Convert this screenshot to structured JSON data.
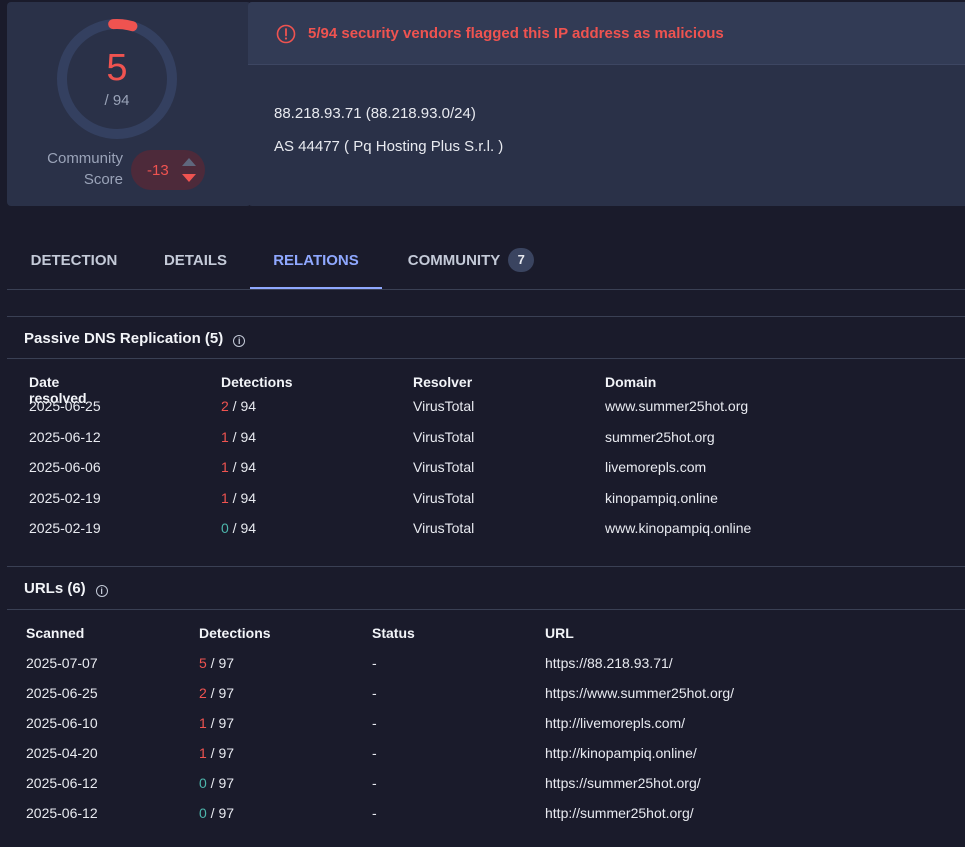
{
  "score": {
    "detections": "5",
    "total": "/ 94",
    "community_label_1": "Community",
    "community_label_2": "Score",
    "community_value": "-13"
  },
  "alert": {
    "text": "5/94 security vendors flagged this IP address as malicious"
  },
  "ip": {
    "line": "88.218.93.71  (88.218.93.0/24)",
    "as_line": "AS 44477  ( Pq Hosting Plus S.r.l. )"
  },
  "tabs": [
    {
      "label": "DETECTION",
      "active": false
    },
    {
      "label": "DETAILS",
      "active": false
    },
    {
      "label": "RELATIONS",
      "active": true
    },
    {
      "label": "COMMUNITY",
      "active": false,
      "badge": "7"
    }
  ],
  "dns": {
    "title": "Passive DNS Replication  (5)",
    "headers": [
      "Date resolved",
      "Detections",
      "Resolver",
      "Domain"
    ],
    "rows": [
      {
        "date": "2025-06-25",
        "det": "2",
        "det_total": " / 94",
        "det_color": "red",
        "resolver": "VirusTotal",
        "domain": "www.summer25hot.org"
      },
      {
        "date": "2025-06-12",
        "det": "1",
        "det_total": " / 94",
        "det_color": "red",
        "resolver": "VirusTotal",
        "domain": "summer25hot.org"
      },
      {
        "date": "2025-06-06",
        "det": "1",
        "det_total": " / 94",
        "det_color": "red",
        "resolver": "VirusTotal",
        "domain": "livemorepls.com"
      },
      {
        "date": "2025-02-19",
        "det": "1",
        "det_total": " / 94",
        "det_color": "red",
        "resolver": "VirusTotal",
        "domain": "kinopampiq.online"
      },
      {
        "date": "2025-02-19",
        "det": "0",
        "det_total": " / 94",
        "det_color": "green",
        "resolver": "VirusTotal",
        "domain": "www.kinopampiq.online"
      }
    ]
  },
  "urls": {
    "title": "URLs  (6)",
    "headers": [
      "Scanned",
      "Detections",
      "Status",
      "URL"
    ],
    "rows": [
      {
        "date": "2025-07-07",
        "det": "5",
        "det_total": " / 97",
        "det_color": "red",
        "status": "-",
        "url": "https://88.218.93.71/"
      },
      {
        "date": "2025-06-25",
        "det": "2",
        "det_total": " / 97",
        "det_color": "red",
        "status": "-",
        "url": "https://www.summer25hot.org/"
      },
      {
        "date": "2025-06-10",
        "det": "1",
        "det_total": " / 97",
        "det_color": "red",
        "status": "-",
        "url": "http://livemorepls.com/"
      },
      {
        "date": "2025-04-20",
        "det": "1",
        "det_total": " / 97",
        "det_color": "red",
        "status": "-",
        "url": "http://kinopampiq.online/"
      },
      {
        "date": "2025-06-12",
        "det": "0",
        "det_total": " / 97",
        "det_color": "green",
        "status": "-",
        "url": "https://summer25hot.org/"
      },
      {
        "date": "2025-06-12",
        "det": "0",
        "det_total": " / 97",
        "det_color": "green",
        "status": "-",
        "url": "http://summer25hot.org/"
      }
    ]
  },
  "colors": {
    "malicious": "#ef5350",
    "clean": "#4db6ac",
    "accent": "#8fa8ff"
  },
  "icons": [
    "alert-circle-icon",
    "info-icon",
    "vote-up-icon",
    "vote-down-icon"
  ]
}
